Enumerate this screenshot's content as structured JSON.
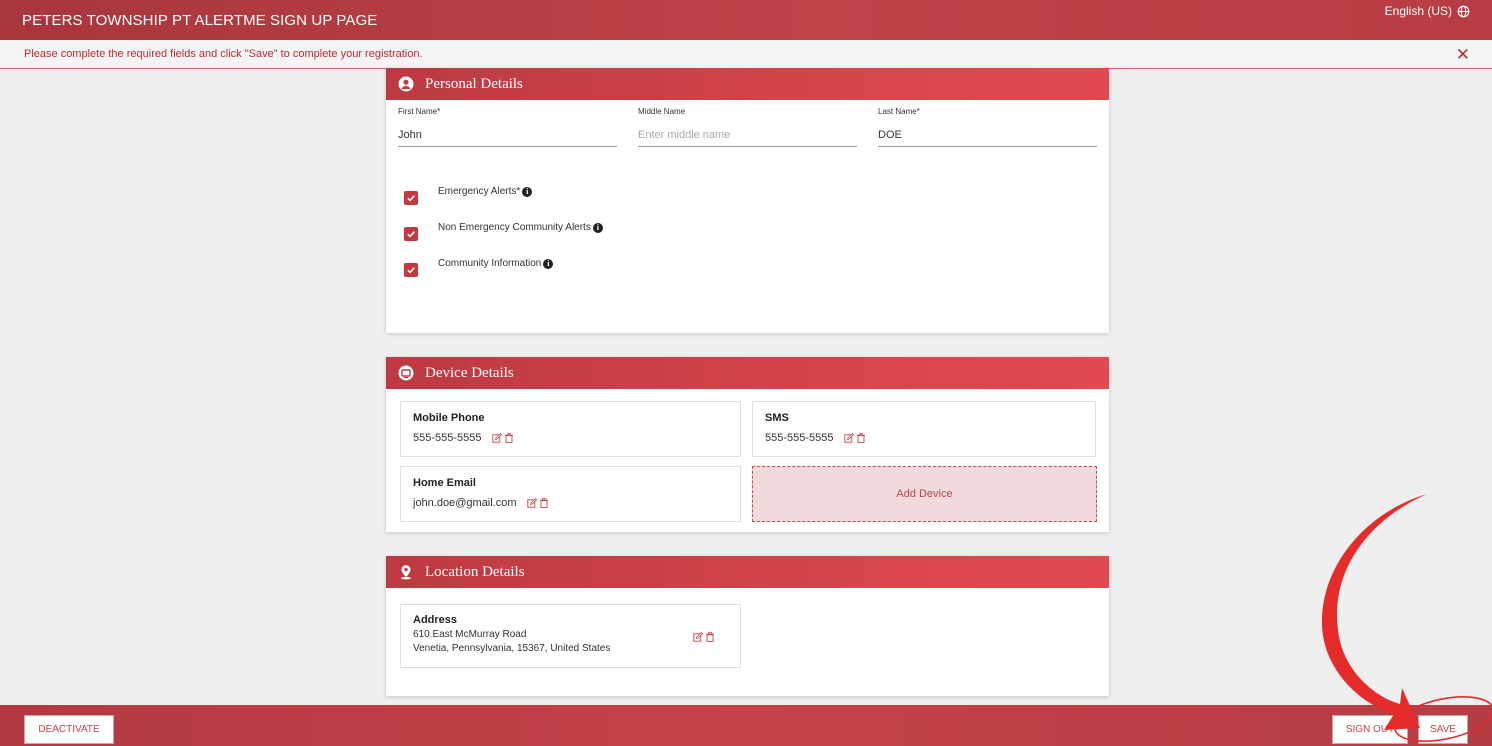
{
  "header": {
    "title": "PETERS TOWNSHIP PT ALERTME SIGN UP PAGE",
    "language": "English (US)"
  },
  "notice": {
    "message": "Please complete the required fields and click \"Save\" to complete your registration.",
    "close_glyph": "✕"
  },
  "personal": {
    "title": "Personal Details",
    "first_name": {
      "label": "First Name*",
      "value": "John"
    },
    "middle_name": {
      "label": "Middle Name",
      "placeholder": "Enter middle name"
    },
    "last_name": {
      "label": "Last Name*",
      "value": "DOE"
    },
    "alerts": [
      {
        "label": "Emergency Alerts*",
        "checked": true
      },
      {
        "label": "Non Emergency Community Alerts",
        "checked": true
      },
      {
        "label": "Community Information",
        "checked": true
      }
    ]
  },
  "devices": {
    "title": "Device Details",
    "items": [
      {
        "type": "Mobile Phone",
        "value": "555-555-5555"
      },
      {
        "type": "SMS",
        "value": "555-555-5555"
      },
      {
        "type": "Home Email",
        "value": "john.doe@gmail.com"
      }
    ],
    "add_label": "Add Device"
  },
  "location": {
    "title": "Location Details",
    "address": {
      "label": "Address",
      "line1": "610 East McMurray Road",
      "line2": "Venetia, Pennsylvania, 15367, United States"
    }
  },
  "footer": {
    "deactivate": "DEACTIVATE",
    "sign_out": "SIGN OUT",
    "save": "SAVE"
  },
  "colors": {
    "brand": "#c0434a",
    "accent": "#e63030"
  }
}
